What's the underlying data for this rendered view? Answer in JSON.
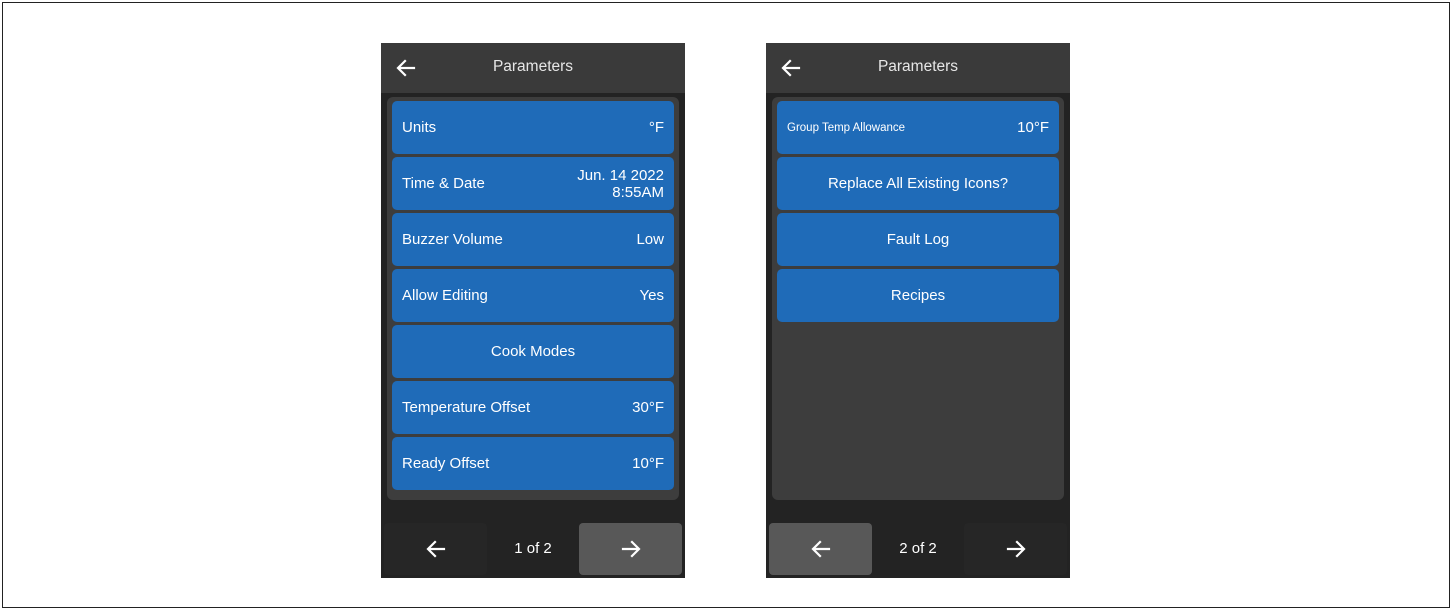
{
  "screen1": {
    "title": "Parameters",
    "rows": [
      {
        "label": "Units",
        "value": "°F"
      },
      {
        "label": "Time & Date",
        "value_line1": "Jun. 14 2022",
        "value_line2": "8:55AM"
      },
      {
        "label": "Buzzer Volume",
        "value": "Low"
      },
      {
        "label": "Allow Editing",
        "value": "Yes"
      },
      {
        "label": "Cook Modes"
      },
      {
        "label": "Temperature Offset",
        "value": "30°F"
      },
      {
        "label": "Ready Offset",
        "value": "10°F"
      }
    ],
    "page_indicator": "1 of 2"
  },
  "screen2": {
    "title": "Parameters",
    "rows": [
      {
        "label": "Group Temp Allowance",
        "value": "10°F"
      },
      {
        "label": "Replace All Existing Icons?"
      },
      {
        "label": "Fault Log"
      },
      {
        "label": "Recipes"
      }
    ],
    "page_indicator": "2 of 2"
  },
  "icons": {
    "back": "arrow-left-icon",
    "prev": "arrow-left-icon",
    "next": "arrow-right-icon"
  },
  "colors": {
    "row_blue": "#1f6bb8",
    "title_bar": "#3a3a3a",
    "panel": "#3d3d3d",
    "device_bg": "#232323",
    "active_nav": "#585858"
  }
}
